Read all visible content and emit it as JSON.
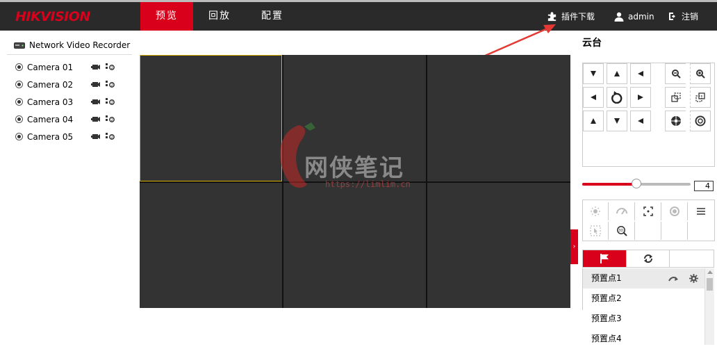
{
  "header": {
    "logo": "HIKVISION",
    "tabs": [
      {
        "label": "预览",
        "active": true
      },
      {
        "label": "回放",
        "active": false
      },
      {
        "label": "配置",
        "active": false
      }
    ],
    "plugin_download": "插件下载",
    "user": "admin",
    "logout": "注销"
  },
  "tree": {
    "root_label": "Network Video Recorder",
    "cameras": [
      {
        "label": "Camera 01"
      },
      {
        "label": "Camera 02"
      },
      {
        "label": "Camera 03"
      },
      {
        "label": "Camera 04"
      },
      {
        "label": "Camera 05"
      }
    ]
  },
  "ptz": {
    "title": "云台",
    "speed": "4",
    "speed_level_fraction": 0.5,
    "presets": [
      {
        "label": "预置点1"
      },
      {
        "label": "预置点2"
      },
      {
        "label": "预置点3"
      },
      {
        "label": "预置点4"
      }
    ]
  },
  "watermark": {
    "title": "网侠笔记",
    "url": "https://limlim.cn"
  },
  "colors": {
    "accent": "#d9001b",
    "topbar": "#2a2a2a",
    "cell": "#333333",
    "selected_cell_border": "#e0b400"
  }
}
